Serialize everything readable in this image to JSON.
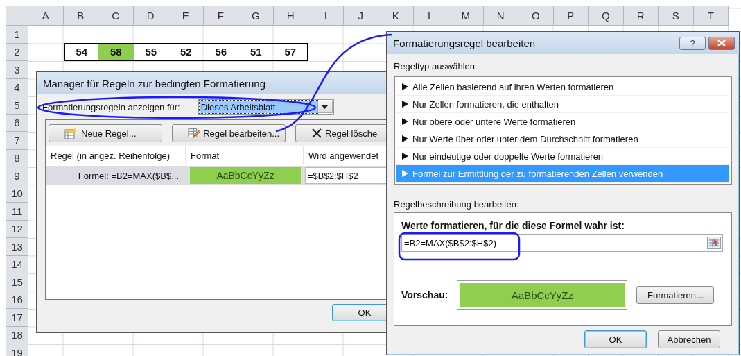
{
  "sheet": {
    "columns": [
      "A",
      "B",
      "C",
      "D",
      "E",
      "F",
      "G",
      "H",
      "I",
      "J",
      "K",
      "L",
      "M",
      "N",
      "O",
      "P",
      "Q",
      "R",
      "S",
      "T"
    ],
    "rows": [
      "1",
      "2",
      "3",
      "4",
      "5",
      "6",
      "7",
      "8",
      "9",
      "10",
      "11",
      "12",
      "13",
      "14",
      "15",
      "16",
      "17",
      "18",
      "19"
    ],
    "data_cells": [
      {
        "value": "54",
        "highlighted": false
      },
      {
        "value": "58",
        "highlighted": true
      },
      {
        "value": "55",
        "highlighted": false
      },
      {
        "value": "52",
        "highlighted": false
      },
      {
        "value": "56",
        "highlighted": false
      },
      {
        "value": "51",
        "highlighted": false
      },
      {
        "value": "57",
        "highlighted": false
      }
    ]
  },
  "rule_manager": {
    "title": "Manager für Regeln zur bedingten Formatierung",
    "show_label": "Formatierungsregeln anzeigen für:",
    "scope": {
      "value": "Dieses Arbeitsblatt",
      "focused": true
    },
    "buttons": [
      {
        "label": "Neue Regel...",
        "kind": "new"
      },
      {
        "label": "Regel bearbeiten...",
        "kind": "edit"
      },
      {
        "label": "Regel lösche",
        "kind": "delete"
      }
    ],
    "columns": [
      "Regel (in angez. Reihenfolge)",
      "Format",
      "Wird angewendet"
    ],
    "rows": [
      {
        "rule": "Formel: =B2=MAX($B$...",
        "preview": "AaBbCcYyZz",
        "applies_to": "=$B$2:$H$2",
        "selected": true
      }
    ],
    "ok": {
      "label": "OK",
      "default": true
    }
  },
  "edit_dialog": {
    "title": "Formatierungsregel bearbeiten",
    "help": "?",
    "rule_type_label": "Regeltyp auswählen:",
    "rule_types": [
      {
        "label": "Alle Zellen basierend auf ihren Werten formatieren",
        "selected": false
      },
      {
        "label": "Nur Zellen formatieren, die enthalten",
        "selected": false
      },
      {
        "label": "Nur obere oder untere Werte formatieren",
        "selected": false
      },
      {
        "label": "Nur Werte über oder unter dem Durchschnitt formatieren",
        "selected": false
      },
      {
        "label": "Nur eindeutige oder doppelte Werte formatieren",
        "selected": false
      },
      {
        "label": "Formel zur Ermittlung der zu formatierenden Zellen verwenden",
        "selected": true
      }
    ],
    "description_label": "Regelbeschreibung bearbeiten:",
    "formula_label": "Werte formatieren, für die diese Formel wahr ist:",
    "formula": "=B2=MAX($B$2:$H$2)",
    "preview_label": "Vorschau:",
    "preview": "AaBbCcYyZz",
    "format_button": "Formatieren...",
    "buttons": [
      {
        "label": "OK",
        "default": true
      },
      {
        "label": "Abbrechen",
        "default": false
      }
    ]
  }
}
